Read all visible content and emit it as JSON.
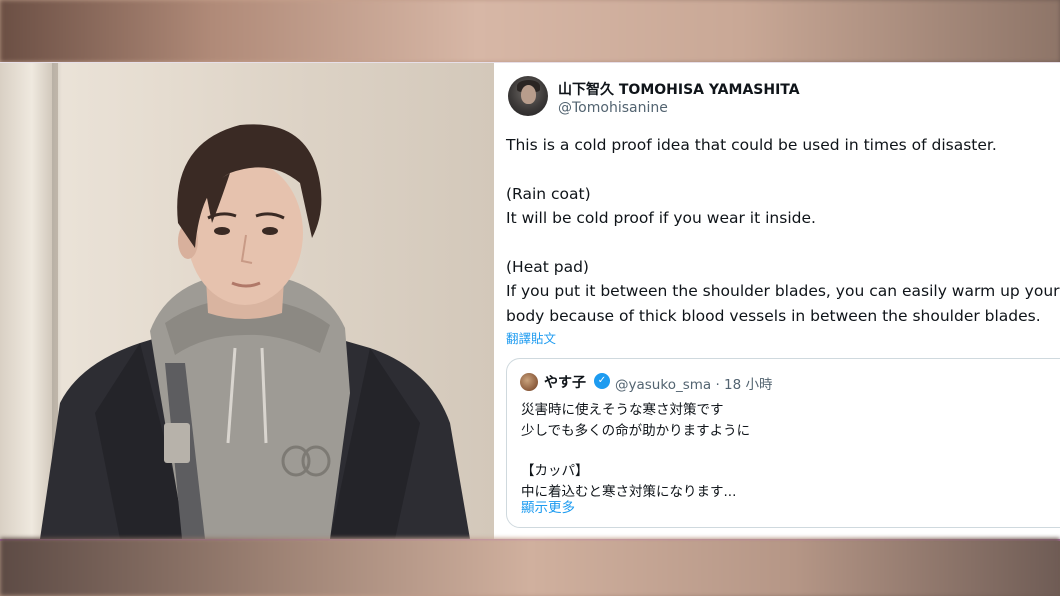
{
  "tweet": {
    "author_name": "山下智久 TOMOHISA YAMASHITA",
    "author_handle": "@Tomohisanine",
    "lines": [
      "This is a cold proof idea that could be used in times of disaster.",
      "(Rain coat)",
      "It will be cold proof if you wear it inside.",
      "(Heat pad)",
      "If you put it between the shoulder blades, you can easily warm up your",
      "body because of thick blood vessels in between the shoulder blades."
    ],
    "translate_label": "翻譯貼文"
  },
  "quote": {
    "name": "やす子",
    "handle_time": "@yasuko_sma · 18 小時",
    "lines": [
      "災害時に使えそうな寒さ対策です",
      "少しでも多くの命が助かりますように",
      "【カッパ】",
      "中に着込むと寒さ対策になります..."
    ],
    "show_more": "顯示更多"
  },
  "colors": {
    "link": "#1d9bf0",
    "text": "#0f1419",
    "muted": "#536471",
    "border": "#cfd9de"
  },
  "icons": {
    "verified": "verified-badge-icon"
  }
}
